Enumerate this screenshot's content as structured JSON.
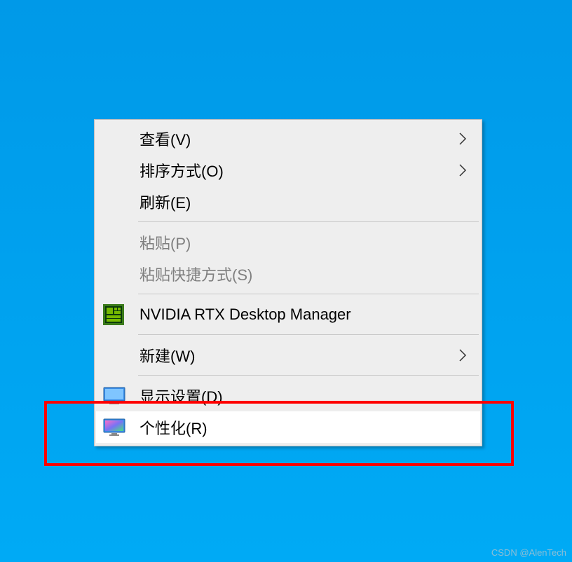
{
  "context_menu": {
    "items": [
      {
        "id": "view",
        "label": "查看(V)",
        "has_submenu": true,
        "enabled": true
      },
      {
        "id": "sort",
        "label": "排序方式(O)",
        "has_submenu": true,
        "enabled": true
      },
      {
        "id": "refresh",
        "label": "刷新(E)",
        "has_submenu": false,
        "enabled": true
      },
      {
        "id": "paste",
        "label": "粘贴(P)",
        "has_submenu": false,
        "enabled": false
      },
      {
        "id": "paste_shortcut",
        "label": "粘贴快捷方式(S)",
        "has_submenu": false,
        "enabled": false
      },
      {
        "id": "nvidia",
        "label": "NVIDIA RTX Desktop Manager",
        "has_submenu": false,
        "enabled": true,
        "icon": "nvidia-icon"
      },
      {
        "id": "new",
        "label": "新建(W)",
        "has_submenu": true,
        "enabled": true
      },
      {
        "id": "display_settings",
        "label": "显示设置(D)",
        "has_submenu": false,
        "enabled": true,
        "icon": "display-icon"
      },
      {
        "id": "personalize",
        "label": "个性化(R)",
        "has_submenu": false,
        "enabled": true,
        "icon": "personalize-icon",
        "hover": true
      }
    ]
  },
  "watermark": "CSDN @AlenTech"
}
